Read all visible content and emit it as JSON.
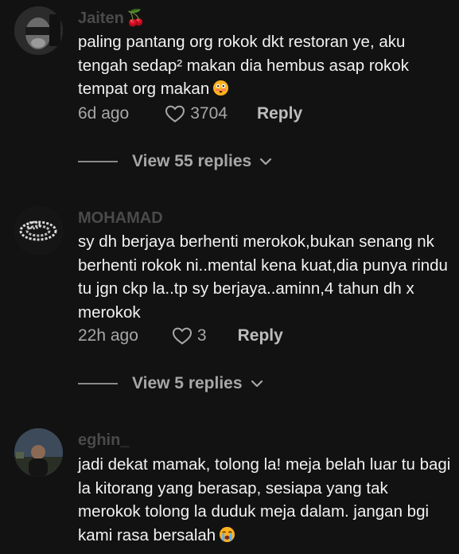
{
  "comments": [
    {
      "username": "Jaiten",
      "username_emoji": "🍒",
      "text": "paling pantang org rokok dkt restoran ye, aku tengah sedap² makan dia hembus asap rokok tempat org makan",
      "emoji": "flushed-face",
      "time": "6d ago",
      "likes": "3704",
      "reply_label": "Reply",
      "replies_label": "View 55 replies"
    },
    {
      "username": "MOHAMAD",
      "text": "sy dh berjaya berhenti merokok,bukan senang nk berhenti rokok ni..mental kena kuat,dia punya rindu tu jgn ckp la..tp sy berjaya..aminn,4 tahun dh x merokok",
      "time": "22h ago",
      "likes": "3",
      "reply_label": "Reply",
      "replies_label": "View 5 replies"
    },
    {
      "username": "eghin_",
      "text": "jadi dekat mamak, tolong la! meja belah luar tu bagi la kitorang yang berasap, sesiapa yang tak merokok tolong la duduk meja dalam. jangan bgi kami rasa bersalah",
      "emoji": "crying-face"
    }
  ],
  "colors": {
    "background": "#121212",
    "text": "#f2f2f2",
    "meta": "#a7a7a7"
  }
}
